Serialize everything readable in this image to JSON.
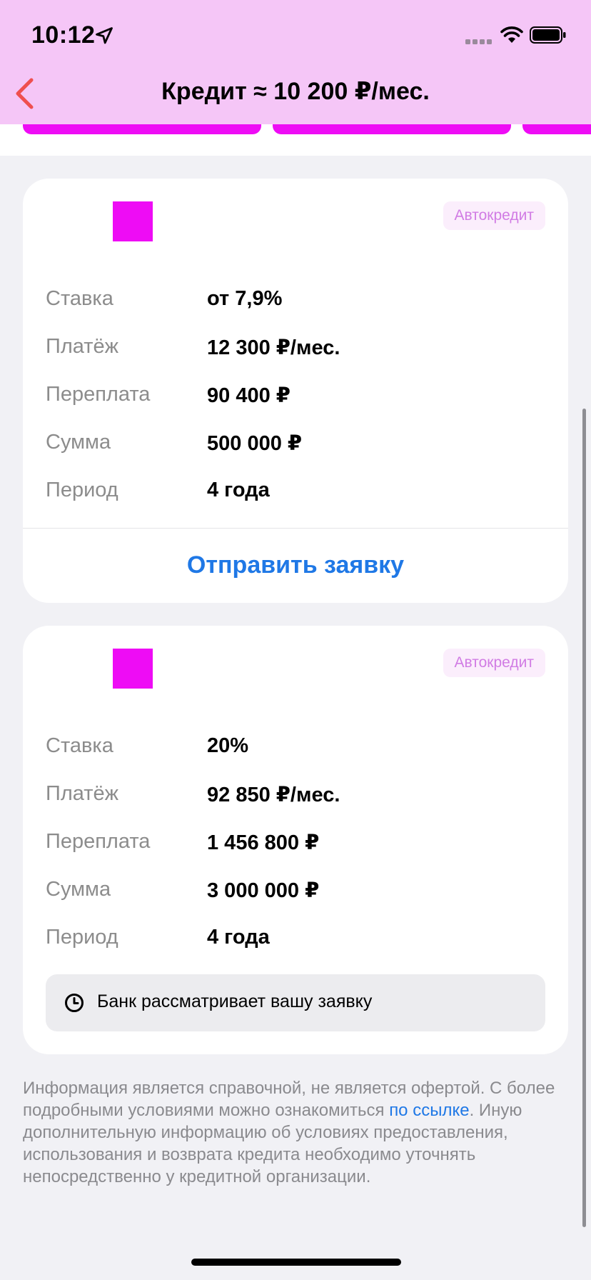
{
  "status_bar": {
    "time": "10:12"
  },
  "nav": {
    "title": "Кредит ≈ 10 200 ₽/мес."
  },
  "cards": [
    {
      "badge": "Автокредит",
      "rows": [
        {
          "label": "Ставка",
          "value": "от 7,9%"
        },
        {
          "label": "Платёж",
          "value": "12 300 ₽/мес."
        },
        {
          "label": "Переплата",
          "value": "90 400 ₽"
        },
        {
          "label": "Сумма",
          "value": "500 000 ₽"
        },
        {
          "label": "Период",
          "value": "4 года"
        }
      ],
      "action": "Отправить заявку"
    },
    {
      "badge": "Автокредит",
      "rows": [
        {
          "label": "Ставка",
          "value": "20%"
        },
        {
          "label": "Платёж",
          "value": "92 850 ₽/мес."
        },
        {
          "label": "Переплата",
          "value": "1 456 800 ₽"
        },
        {
          "label": "Сумма",
          "value": "3 000 000 ₽"
        },
        {
          "label": "Период",
          "value": "4 года"
        }
      ],
      "status": "Банк рассматривает вашу заявку"
    }
  ],
  "disclaimer": {
    "text_before": "Информация является справочной, не является офертой. С более подробными условиями можно ознакомиться ",
    "link": "по ссылке",
    "text_after": ". Иную дополнительную информацию об условиях предоставления, использования и возврата кредита необходимо уточнять непосредственно у кредитной организации."
  },
  "colors": {
    "header": "#f5c6f7",
    "accent_magenta": "#ee0cf5",
    "link_blue": "#1f78e6",
    "back_red": "#ef4f4f"
  },
  "icons": [
    "location-arrow-icon",
    "signal-icon",
    "wifi-icon",
    "battery-icon",
    "chevron-left-icon",
    "clock-icon"
  ]
}
